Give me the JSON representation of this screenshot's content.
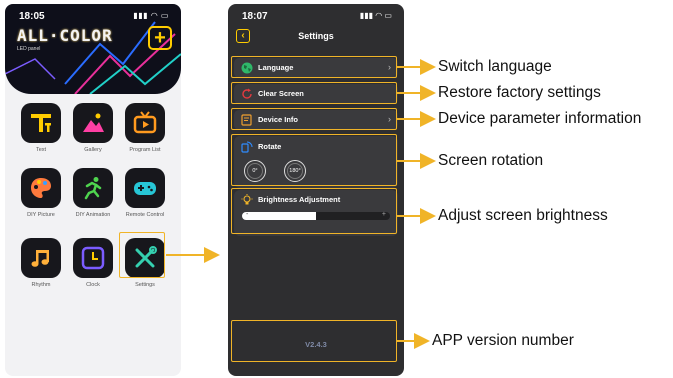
{
  "home_screen": {
    "status_time": "18:05",
    "status_icons": "signal-wifi-battery",
    "app_logo_text": "ALL·COLOR",
    "app_logo_sub": "LED panel",
    "add_button_icon": "plus-icon",
    "tiles": [
      {
        "label": "Text",
        "icon": "text-icon",
        "color": "#ffcc00"
      },
      {
        "label": "Gallery",
        "icon": "gallery-icon",
        "color": "#ff3fa4"
      },
      {
        "label": "Program List",
        "icon": "tv-icon",
        "color": "#ff9a1f"
      },
      {
        "label": "DIY Picture",
        "icon": "palette-icon",
        "color": "#ff7a3d"
      },
      {
        "label": "DIY Animation",
        "icon": "running-person-icon",
        "color": "#4fd44f"
      },
      {
        "label": "Remote Control",
        "icon": "gamepad-icon",
        "color": "#27c6d6"
      },
      {
        "label": "Rhythm",
        "icon": "music-note-icon",
        "color": "#ffb03a"
      },
      {
        "label": "Clock",
        "icon": "clock-icon",
        "color": "#7b5cff"
      },
      {
        "label": "Settings",
        "icon": "tools-icon",
        "color": "#35d0b0"
      }
    ]
  },
  "settings_screen": {
    "status_time": "18:07",
    "title": "Settings",
    "back_icon": "chevron-left-icon",
    "items": {
      "language": "Language",
      "clear_screen": "Clear Screen",
      "device_info": "Device Info"
    },
    "rotate": {
      "label": "Rotate",
      "options": [
        "0°",
        "180°"
      ]
    },
    "brightness": {
      "label": "Brightness Adjustment",
      "value_fraction": 0.5,
      "minus": "-",
      "plus": "+"
    },
    "version": "V2.4.3"
  },
  "callouts": {
    "language": "Switch language",
    "clear_screen": "Restore factory settings",
    "device_info": "Device parameter information",
    "rotate": "Screen rotation",
    "brightness": "Adjust screen brightness",
    "version": "APP version number"
  },
  "colors": {
    "accent": "#ffcc00",
    "highlight": "#f0b428",
    "settings_bg": "#2e2e30",
    "row_bg": "#3a3a3d"
  }
}
